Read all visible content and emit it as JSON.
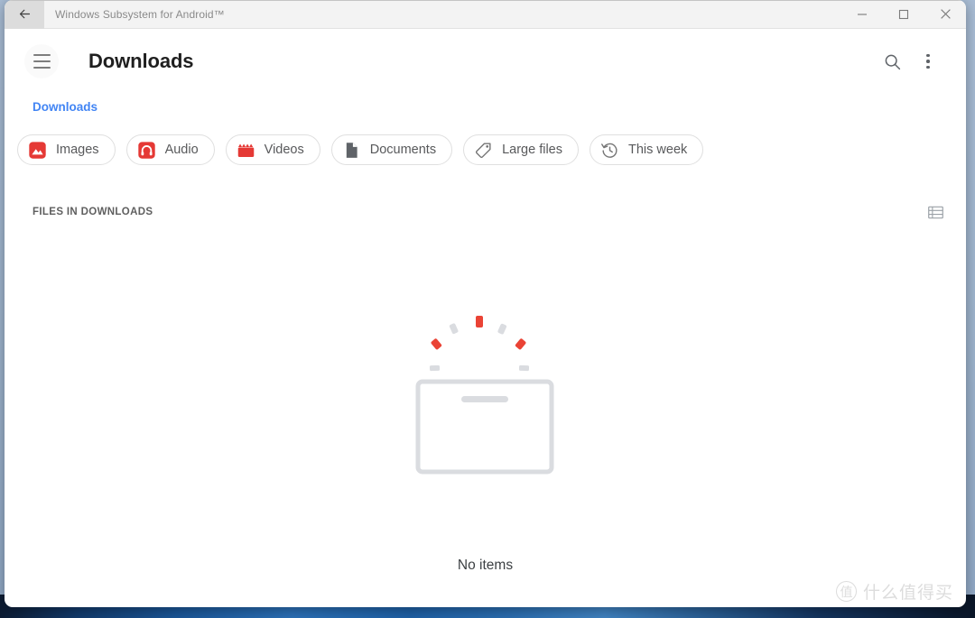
{
  "window": {
    "title": "Windows Subsystem for Android™",
    "back_icon": "back-arrow-icon",
    "controls": {
      "minimize": "minimize-icon",
      "maximize": "maximize-icon",
      "close": "close-icon"
    }
  },
  "header": {
    "menu_icon": "hamburger-menu-icon",
    "title": "Downloads",
    "search_icon": "search-icon",
    "overflow_icon": "more-vertical-icon"
  },
  "breadcrumb": {
    "current": "Downloads"
  },
  "chips": [
    {
      "label": "Images",
      "icon": "image-icon",
      "color": "#e53935"
    },
    {
      "label": "Audio",
      "icon": "headphones-icon",
      "color": "#e53935"
    },
    {
      "label": "Videos",
      "icon": "clapperboard-icon",
      "color": "#e53935"
    },
    {
      "label": "Documents",
      "icon": "document-icon",
      "color": "#5f6368"
    },
    {
      "label": "Large files",
      "icon": "tag-icon",
      "color": "#757575"
    },
    {
      "label": "This week",
      "icon": "history-icon",
      "color": "#757575"
    }
  ],
  "section": {
    "label": "FILES IN DOWNLOADS",
    "view_toggle_icon": "list-view-icon"
  },
  "empty_state": {
    "illustration": "empty-box-confetti-illustration",
    "message": "No items",
    "box_color": "#dadce0",
    "confetti_gray": "#dadce0",
    "confetti_red": "#ea4335"
  },
  "watermark": {
    "mark": "值",
    "text": "什么值得买"
  },
  "theme": {
    "accent": "#4285f4",
    "brand_red": "#e53935",
    "titlebar_bg": "#f3f3f3",
    "desktop_bg": "#9db3cc"
  }
}
